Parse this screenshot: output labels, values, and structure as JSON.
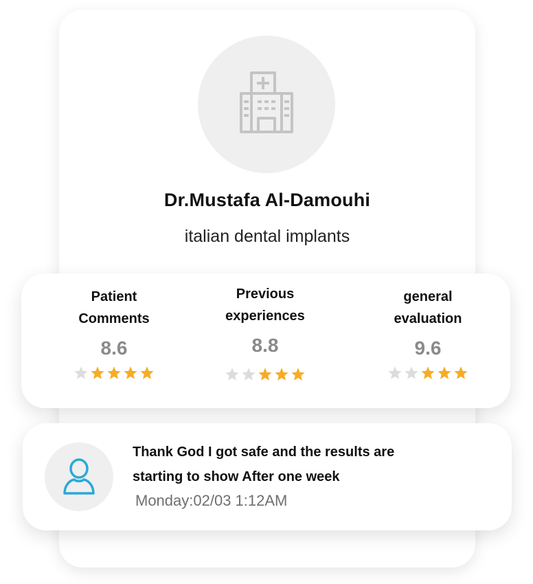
{
  "doctor": {
    "name": "Dr.Mustafa Al-Damouhi",
    "specialty": "italian dental implants",
    "avatar_icon": "hospital-building-icon"
  },
  "ratings": [
    {
      "label_line1": "Patient",
      "label_line2": "Comments",
      "score": "8.6",
      "stars_filled": 4,
      "stars_total": 5
    },
    {
      "label_line1": "Previous",
      "label_line2": "experiences",
      "score": "8.8",
      "stars_filled": 3,
      "stars_total": 5
    },
    {
      "label_line1": "general",
      "label_line2": "evaluation",
      "score": "9.6",
      "stars_filled": 3,
      "stars_total": 5
    }
  ],
  "comment": {
    "line1": "Thank God I got safe and the results are",
    "line2": "starting to show After one week",
    "time": "Monday:02/03 1:12AM",
    "avatar_icon": "user-icon"
  },
  "colors": {
    "star_filled": "#f5ad26",
    "star_empty": "#dcdcdc",
    "user_icon": "#2aa9d8",
    "building_icon": "#c4c4c4"
  }
}
